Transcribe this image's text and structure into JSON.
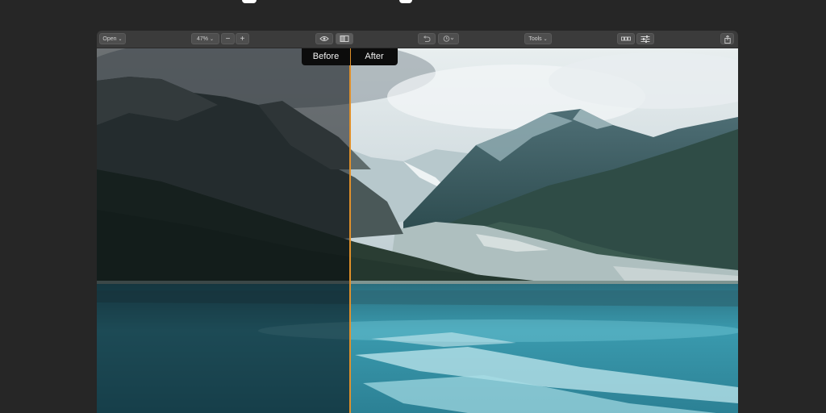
{
  "toolbar": {
    "open_label": "Open",
    "zoom_value": "47%",
    "zoom_out_symbol": "−",
    "zoom_in_symbol": "+",
    "tools_label": "Tools",
    "icons": [
      "eye-icon",
      "split-view-icon",
      "undo-icon",
      "history-icon",
      "grid-view-icon",
      "adjustments-icon",
      "share-icon"
    ]
  },
  "compare": {
    "before_label": "Before",
    "after_label": "After",
    "split_position": 0.395,
    "split_color": "#e0902a"
  },
  "colors": {
    "background": "#262626",
    "toolbar": "#3b3b3b",
    "sky": "#dfe6e8",
    "water": "#3fa7b8"
  }
}
